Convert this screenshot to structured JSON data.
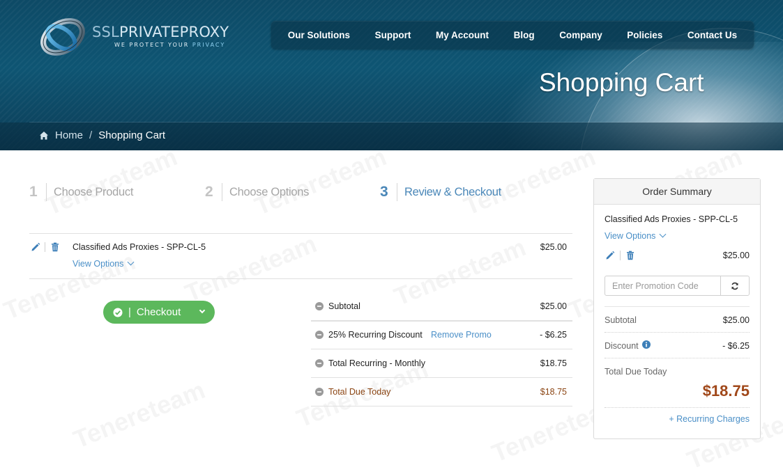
{
  "brand": {
    "name_prefix": "SSL",
    "name_rest": "PRIVATEPROXY",
    "tagline_main": "WE PROTECT YOUR",
    "tagline_accent": "PRIVACY"
  },
  "nav": {
    "items": [
      "Our Solutions",
      "Support",
      "My Account",
      "Blog",
      "Company",
      "Policies",
      "Contact Us"
    ]
  },
  "page_title": "Shopping Cart",
  "breadcrumb": {
    "home": "Home",
    "separator": "/",
    "current": "Shopping Cart"
  },
  "steps": [
    {
      "number": "1",
      "label": "Choose Product",
      "active": false
    },
    {
      "number": "2",
      "label": "Choose Options",
      "active": false
    },
    {
      "number": "3",
      "label": "Review & Checkout",
      "active": true
    }
  ],
  "cart_item": {
    "name": "Classified Ads Proxies - SPP-CL-5",
    "view_options": "View Options",
    "price": "$25.00"
  },
  "checkout": {
    "label": "Checkout",
    "separator": "|"
  },
  "totals": {
    "subtotal_label": "Subtotal",
    "subtotal_value": "$25.00",
    "discount_label": "25% Recurring Discount",
    "remove_promo": "Remove Promo",
    "discount_value": "- $6.25",
    "recurring_label": "Total Recurring - Monthly",
    "recurring_value": "$18.75",
    "due_label": "Total Due Today",
    "due_value": "$18.75"
  },
  "summary": {
    "title": "Order Summary",
    "item_name": "Classified Ads Proxies - SPP-CL-5",
    "view_options": "View Options",
    "item_price": "$25.00",
    "promo_placeholder": "Enter Promotion Code",
    "subtotal_label": "Subtotal",
    "subtotal_value": "$25.00",
    "discount_label": "Discount",
    "discount_value": "- $6.25",
    "due_label": "Total Due Today",
    "due_value": "$18.75",
    "recurring_link": "+ Recurring Charges"
  },
  "watermark": "Tenereteam",
  "colors": {
    "header_bg": "#0e5573",
    "accent_blue": "#4a8fc7",
    "checkout_green": "#5cb85c",
    "due_brown": "#a0481a"
  }
}
